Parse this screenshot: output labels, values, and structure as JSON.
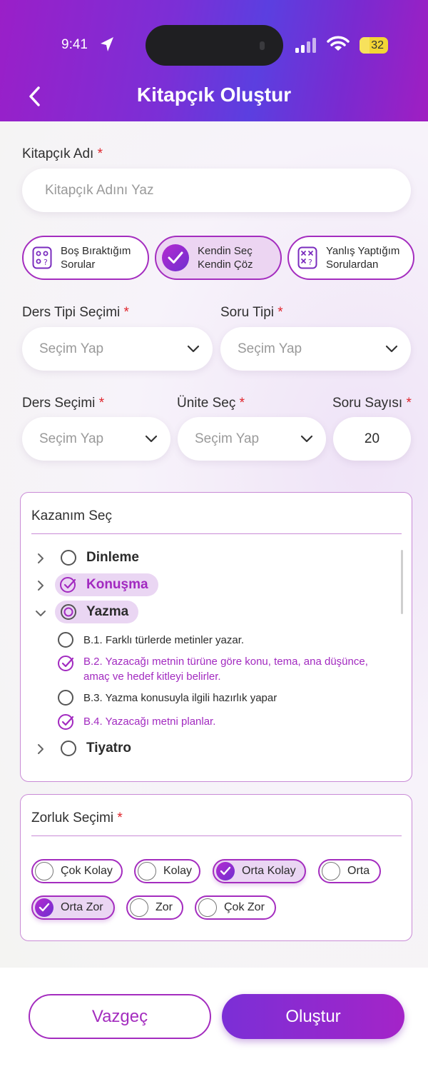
{
  "status_bar": {
    "time": "9:41",
    "battery": "32"
  },
  "header": {
    "title": "Kitapçık Oluştur"
  },
  "form": {
    "booklet_name": {
      "label": "Kitapçık Adı",
      "required": "*",
      "placeholder": "Kitapçık Adını Yaz"
    },
    "modes": [
      {
        "line1": "Boş Bıraktığım",
        "line2": "Sorular",
        "icon": "grid-question-icon",
        "selected": false
      },
      {
        "line1": "Kendin Seç",
        "line2": "Kendin Çöz",
        "icon": "check-circle-icon",
        "selected": true
      },
      {
        "line1": "Yanlış Yaptığım",
        "line2": "Sorulardan",
        "icon": "x-question-icon",
        "selected": false
      }
    ],
    "lesson_type": {
      "label": "Ders Tipi Seçimi",
      "value": "Seçim Yap"
    },
    "question_type": {
      "label": "Soru Tipi",
      "value": "Seçim Yap"
    },
    "lesson": {
      "label": "Ders Seçimi",
      "value": "Seçim Yap"
    },
    "unit": {
      "label": "Ünite Seç",
      "value": "Seçim Yap"
    },
    "question_count": {
      "label": "Soru Sayısı",
      "value": "20"
    },
    "required_mark": "*"
  },
  "outcomes": {
    "title": "Kazanım Seç",
    "items": [
      {
        "name": "Dinleme",
        "state": "none"
      },
      {
        "name": "Konuşma",
        "state": "checked"
      },
      {
        "name": "Yazma",
        "state": "partial"
      },
      {
        "name": "Tiyatro",
        "state": "none"
      }
    ],
    "sub_items": [
      {
        "text": "B.1. Farklı türlerde metinler yazar.",
        "checked": false
      },
      {
        "text": "B.2. Yazacağı metnin türüne göre konu, tema, ana düşünce,",
        "text2": "amaç ve hedef kitleyi belirler.",
        "checked": true
      },
      {
        "text": "B.3. Yazma konusuyla ilgili hazırlık yapar",
        "checked": false
      },
      {
        "text": "B.4. Yazacağı metni planlar.",
        "checked": true
      }
    ]
  },
  "difficulty": {
    "title": "Zorluk Seçimi",
    "required": "*",
    "options": [
      {
        "label": "Çok Kolay",
        "selected": false
      },
      {
        "label": "Kolay",
        "selected": false
      },
      {
        "label": "Orta Kolay",
        "selected": true
      },
      {
        "label": "Orta",
        "selected": false
      },
      {
        "label": "Orta Zor",
        "selected": true
      },
      {
        "label": "Zor",
        "selected": false
      },
      {
        "label": "Çok Zor",
        "selected": false
      }
    ]
  },
  "actions": {
    "cancel": "Vazgeç",
    "create": "Oluştur"
  },
  "colors": {
    "accent": "#a42dbf",
    "header_start": "#9a1fc8",
    "header_mid": "#5b3fe0",
    "required": "#e0242b"
  }
}
